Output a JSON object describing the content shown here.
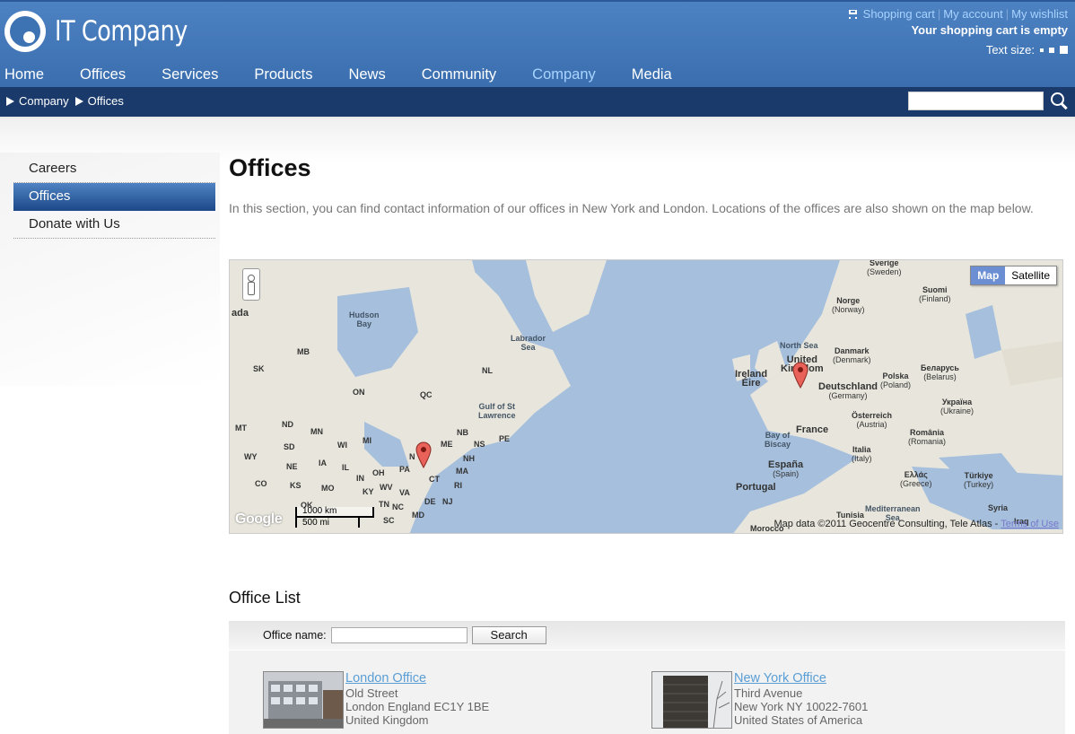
{
  "header": {
    "logo_text": "IT Company",
    "top_links": [
      "Shopping cart",
      "My account",
      "My wishlist"
    ],
    "cart_status": "Your shopping cart is empty",
    "text_size_label": "Text size:"
  },
  "nav": {
    "items": [
      "Home",
      "Offices",
      "Services",
      "Products",
      "News",
      "Community",
      "Company",
      "Media"
    ],
    "active": "Company"
  },
  "breadcrumb": [
    "Company",
    "Offices"
  ],
  "search": {
    "value": ""
  },
  "sidebar": {
    "items": [
      "Careers",
      "Offices",
      "Donate with Us"
    ],
    "active": "Offices"
  },
  "main": {
    "title": "Offices",
    "intro": "In this section, you can find contact information of our offices in New York and London. Locations of the offices are also shown on the map below."
  },
  "map": {
    "type_buttons": [
      "Map",
      "Satellite"
    ],
    "active_type": "Map",
    "copyright_prefix": "Map data ©2011 Geocentre Consulting, Tele Atlas - ",
    "terms_link": "Terms of Use",
    "google_logo": "Google",
    "scale_km": "1000 km",
    "scale_mi": "500 mi",
    "labels": {
      "canada": "ada",
      "hudson_bay": [
        "Hudson",
        "Bay"
      ],
      "labrador_sea": [
        "Labrador",
        "Sea"
      ],
      "mb": "MB",
      "sk": "SK",
      "on": "ON",
      "qc": "QC",
      "nl": "NL",
      "gulf": [
        "Gulf of St",
        "Lawrence"
      ],
      "mt": "MT",
      "nd": "ND",
      "mn": "MN",
      "sd": "SD",
      "wi": "WI",
      "mi": "MI",
      "wy": "WY",
      "ne": "NE",
      "ia": "IA",
      "co": "CO",
      "ks": "KS",
      "mo": "MO",
      "il": "IL",
      "in": "IN",
      "oh": "OH",
      "pa": "PA",
      "ky": "KY",
      "wv": "WV",
      "va": "VA",
      "tn": "TN",
      "nc": "NC",
      "sc": "SC",
      "ok": "OK",
      "ny": "N",
      "me": "ME",
      "nb": "NB",
      "ns": "NS",
      "pe": "PE",
      "nh": "NH",
      "ma": "MA",
      "ct": "CT",
      "ri": "RI",
      "nj": "NJ",
      "de": "DE",
      "md": "MD",
      "sverige": [
        "Sverige",
        "(Sweden)"
      ],
      "norge": [
        "Norge",
        "(Norway)"
      ],
      "suomi": [
        "Suomi",
        "(Finland)"
      ],
      "north_sea": "North Sea",
      "denmark": [
        "Danmark",
        "(Denmark)"
      ],
      "uk": [
        "United",
        "Kingdom"
      ],
      "ireland": [
        "Ireland",
        "Éire"
      ],
      "belarus": [
        "Беларусь",
        "(Belarus)"
      ],
      "polska": [
        "Polska",
        "(Poland)"
      ],
      "deutschland": [
        "Deutschland",
        "(Germany)"
      ],
      "ukraine": [
        "Україна",
        "(Ukraine)"
      ],
      "austria": [
        "Österreich",
        "(Austria)"
      ],
      "france": "France",
      "biscay": [
        "Bay of",
        "Biscay"
      ],
      "romania": [
        "România",
        "(Romania)"
      ],
      "italia": [
        "Italia",
        "(Italy)"
      ],
      "espana": [
        "España",
        "(Spain)"
      ],
      "portugal": "Portugal",
      "greece": [
        "Ελλάς",
        "(Greece)"
      ],
      "turkey": [
        "Türkiye",
        "(Turkey)"
      ],
      "med": [
        "Mediterranean",
        "Sea"
      ],
      "tunisia": "Tunisia",
      "syria": "Syria",
      "iraq": "Iraq",
      "morocco": "Morocco"
    }
  },
  "office_list": {
    "title": "Office List",
    "filter_label": "Office name:",
    "filter_value": "",
    "search_button": "Search",
    "offices": [
      {
        "name": "London Office",
        "street": "Old Street",
        "city": "London England EC1Y 1BE",
        "country": "United Kingdom"
      },
      {
        "name": "New York Office",
        "street": "Third Avenue",
        "city": "New York NY 10022-7601",
        "country": "United States of America"
      }
    ]
  }
}
